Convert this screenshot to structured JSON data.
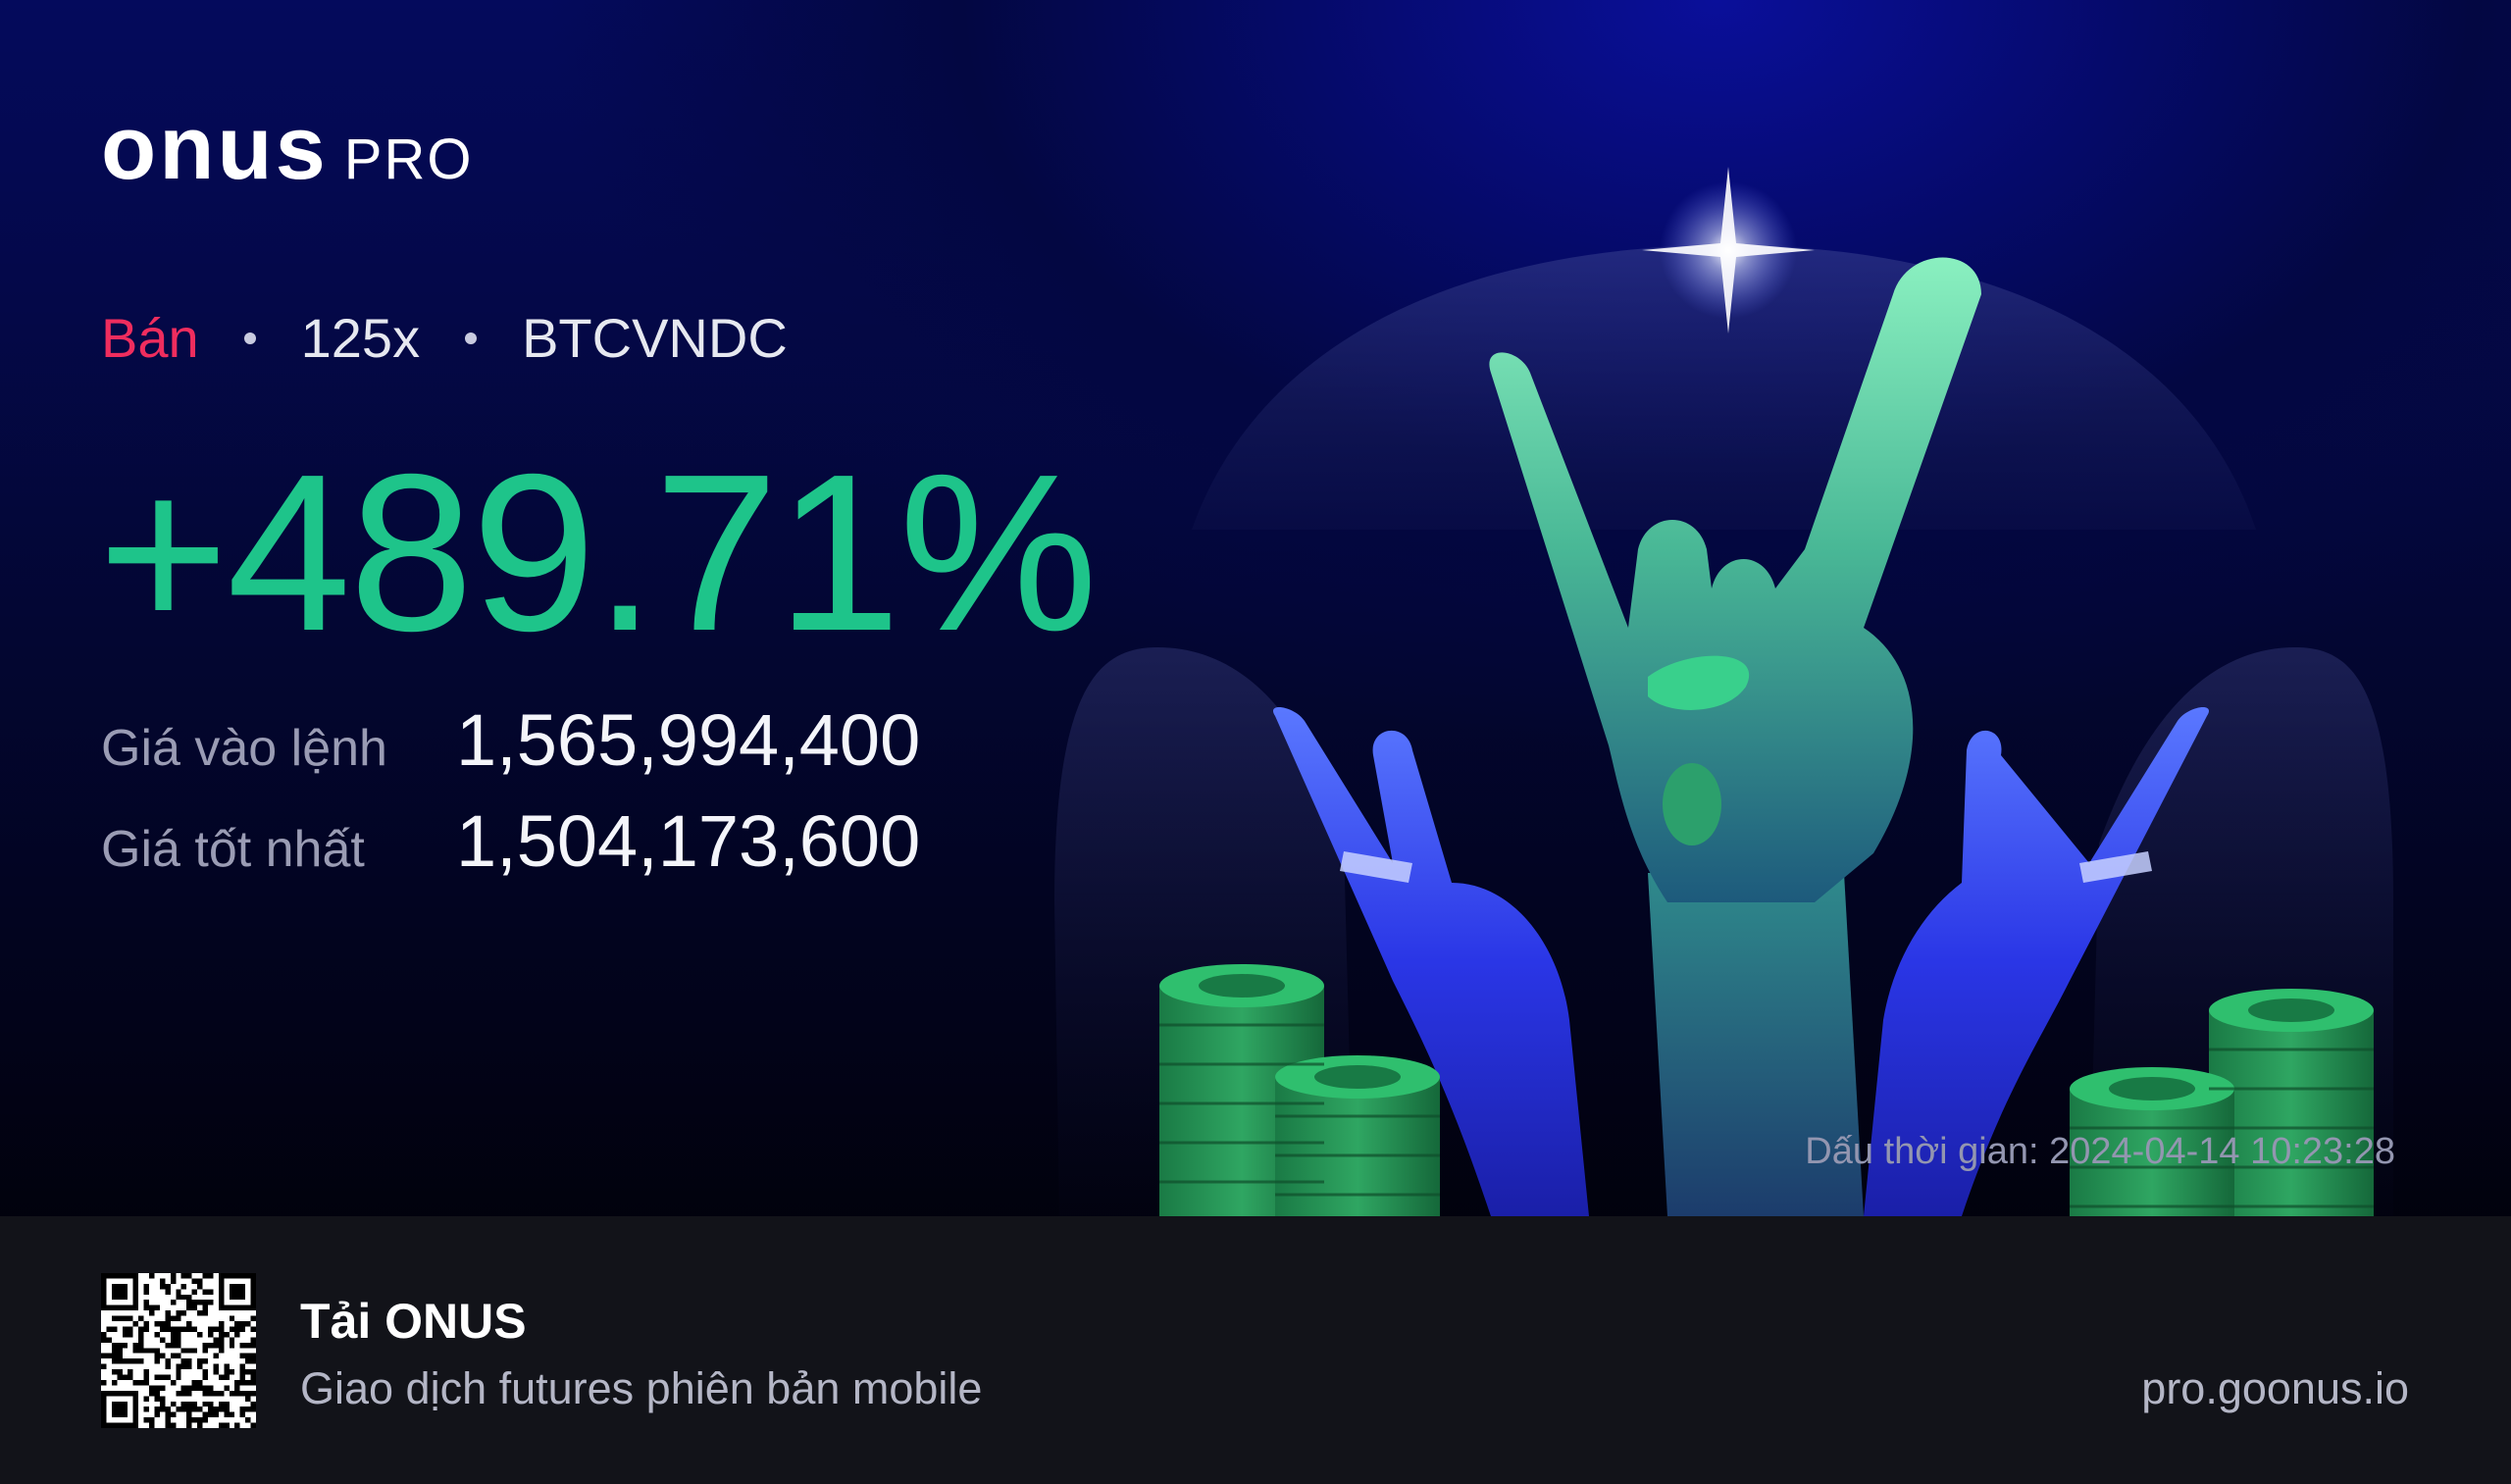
{
  "brand": {
    "logo_main": "onus",
    "logo_suffix": "PRO"
  },
  "trade": {
    "side": "Bán",
    "leverage": "125x",
    "pair": "BTCVNDC",
    "roi": "+489.71%"
  },
  "prices": [
    {
      "label": "Giá vào lệnh",
      "value": "1,565,994,400"
    },
    {
      "label": "Giá tốt nhất",
      "value": "1,504,173,600"
    }
  ],
  "timestamp": "Dấu thời gian: 2024-04-14 10:23:28",
  "footer": {
    "app_title": "Tải ONUS",
    "app_subtitle": "Giao dịch futures phiên bản mobile",
    "website": "pro.goonus.io"
  },
  "colors": {
    "sell": "#ef2d5e",
    "profit": "#1ec48a",
    "background_top": "#050a6a",
    "footer_bg": "#121319"
  },
  "icons": {
    "illustration": "rock-on-hands-with-coin-stacks",
    "qr": "qr-code-icon"
  }
}
